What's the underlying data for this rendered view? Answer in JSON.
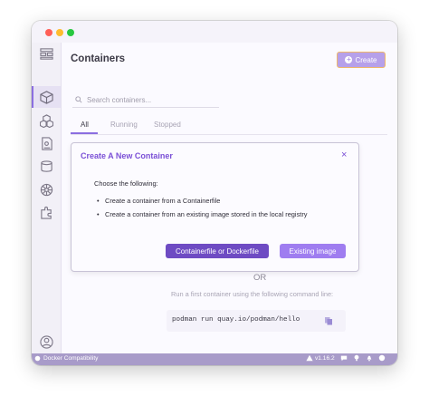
{
  "page": {
    "title": "Containers"
  },
  "header": {
    "create_label": "Create"
  },
  "search": {
    "placeholder": "Search containers..."
  },
  "tabs": [
    {
      "label": "All",
      "active": true
    },
    {
      "label": "Running",
      "active": false
    },
    {
      "label": "Stopped",
      "active": false
    }
  ],
  "sidebar": {
    "items": [
      {
        "icon": "dashboard-icon",
        "active": false
      },
      {
        "icon": "containers-icon",
        "active": true
      },
      {
        "icon": "pods-icon",
        "active": false
      },
      {
        "icon": "images-icon",
        "active": false
      },
      {
        "icon": "volumes-icon",
        "active": false
      },
      {
        "icon": "kubernetes-icon",
        "active": false
      },
      {
        "icon": "extensions-icon",
        "active": false
      }
    ],
    "bottom": [
      {
        "icon": "account-icon"
      },
      {
        "icon": "settings-icon"
      }
    ]
  },
  "modal": {
    "title": "Create A New Container",
    "close_label": "×",
    "intro": "Choose the following:",
    "bullets": [
      "Create a container from a Containerfile",
      "Create a container from an existing image stored in the local registry"
    ],
    "primary_button": "Containerfile or Dockerfile",
    "secondary_button": "Existing image"
  },
  "empty_state": {
    "or_text": "OR",
    "hint": "Run a first container using the following command line:",
    "command": "podman run quay.io/podman/hello"
  },
  "statusbar": {
    "left_label": "Docker Compatibility",
    "version": "v1.16.2",
    "accent_color": "#a89bc9"
  },
  "colors": {
    "accent": "#8b6ee0",
    "primary_button": "#6e4bc3",
    "secondary_button": "#9f7df0"
  }
}
